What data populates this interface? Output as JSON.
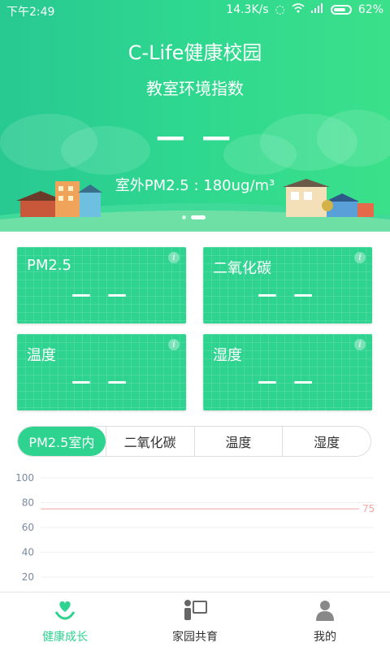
{
  "status_bar": {
    "time": "下午2:49",
    "speed": "14.3K/s",
    "battery": "62%"
  },
  "header": {
    "title": "C-Life健康校园",
    "subtitle": "教室环境指数",
    "main_value": "— —",
    "outdoor_text": "室外PM2.5 : 180ug/m³"
  },
  "cards": [
    {
      "label": "PM2.5",
      "value": "— —"
    },
    {
      "label": "二氧化碳",
      "value": "— —"
    },
    {
      "label": "温度",
      "value": "— —"
    },
    {
      "label": "湿度",
      "value": "— —"
    }
  ],
  "tabs": [
    "PM2.5室内",
    "二氧化碳",
    "温度",
    "湿度"
  ],
  "chart_data": {
    "type": "line",
    "y_ticks": [
      100,
      80,
      60,
      40,
      20
    ],
    "ylim": [
      0,
      100
    ],
    "reference_line": {
      "value": 75,
      "label": "75",
      "color": "#f5a3a3"
    },
    "series": []
  },
  "bottom_nav": [
    {
      "label": "健康成长",
      "icon": "heart-hands-icon"
    },
    {
      "label": "家园共育",
      "icon": "parent-board-icon"
    },
    {
      "label": "我的",
      "icon": "user-icon"
    }
  ],
  "colors": {
    "accent": "#2ed38f"
  }
}
